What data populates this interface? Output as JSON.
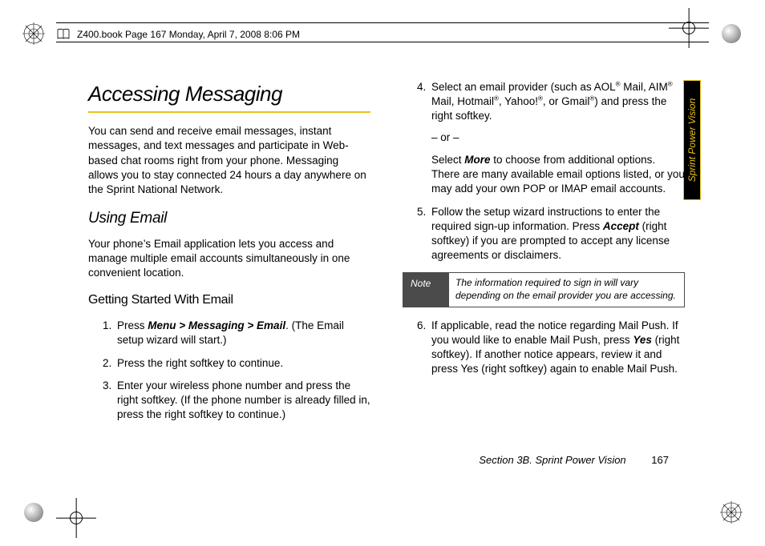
{
  "header": {
    "book_stamp": "Z400.book  Page 167  Monday, April 7, 2008  8:06 PM"
  },
  "side_tab": "Sprint Power Vision",
  "left": {
    "h1": "Accessing Messaging",
    "intro": "You can send and receive email messages, instant messages, and text messages and participate in Web-based chat rooms right from your phone. Messaging allows you to stay connected 24 hours a day anywhere on the Sprint National Network.",
    "h2": "Using Email",
    "p2": "Your phone’s Email application lets you access and manage multiple email accounts simultaneously in one convenient location.",
    "h3": "Getting Started With Email",
    "s1_a": "Press ",
    "s1_b": "Menu > Messaging > Email",
    "s1_c": ". (The Email setup wizard will start.)",
    "s2": "Press the right softkey to continue.",
    "s3": "Enter your wireless phone number and press the right softkey. (If the phone number is already filled in, press the right softkey to continue.)"
  },
  "right": {
    "s4_a": "Select an email provider (such as AOL",
    "s4_b": " Mail, AIM",
    "s4_c": " Mail, Hotmail",
    "s4_d": ", Yahoo!",
    "s4_e": ", or Gmail",
    "s4_f": ") and press the right softkey.",
    "s4_or": "– or –",
    "s4_g1": "Select ",
    "s4_g2": "More",
    "s4_g3": " to choose from additional options. There are many available email options listed, or you may add your own POP or IMAP email accounts.",
    "s5_a": "Follow the setup wizard instructions to enter the required sign-up information. Press ",
    "s5_b": "Accept",
    "s5_c": " (right softkey) if you are prompted to accept any license agreements or disclaimers.",
    "note_label": "Note",
    "note_body": "The information required to sign in will vary depending on the email provider you are accessing.",
    "s6_a": "If applicable, read the notice regarding Mail Push. If you would like to enable Mail Push, press ",
    "s6_b": "Yes",
    "s6_c": " (right softkey). If another notice appears, review it and press Yes (right softkey) again to enable Mail Push."
  },
  "footer": {
    "section": "Section 3B. Sprint Power Vision",
    "page": "167"
  },
  "reg": "®"
}
